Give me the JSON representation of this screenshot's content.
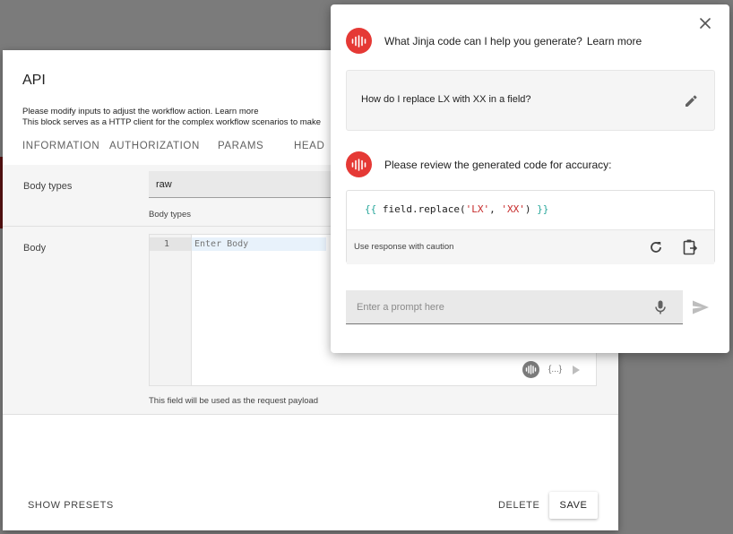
{
  "api_dialog": {
    "title": "API",
    "description_line1": "Please modify inputs to adjust the workflow action.",
    "learn_more": "Learn more",
    "description_line2": "This block serves as a HTTP client for the complex workflow scenarios to make",
    "tabs": [
      "INFORMATION",
      "AUTHORIZATION",
      "PARAMS",
      "HEAD"
    ],
    "body_types_label": "Body types",
    "body_types_value": "raw",
    "body_types_helper": "Body types",
    "body_label": "Body",
    "editor_line_number": "1",
    "editor_placeholder": "Enter Body",
    "editor_braces": "{...}",
    "body_helper": "This field will be used as the request payload",
    "footer": {
      "show_presets": "SHOW PRESETS",
      "delete": "DELETE",
      "save": "SAVE"
    }
  },
  "ai_panel": {
    "question_title": "What Jinja code can I help you generate?",
    "learn_more": "Learn more",
    "user_prompt": "How do I replace LX with XX in a field?",
    "review_title": "Please review the generated code for accuracy:",
    "code": {
      "open": "{{ ",
      "func": "field.replace(",
      "arg1": "'LX'",
      "sep": ", ",
      "arg2": "'XX'",
      "close_paren": ") ",
      "close": "}}"
    },
    "caution": "Use response with caution",
    "input_placeholder": "Enter a prompt here",
    "icons": [
      "waveform-icon",
      "close-icon",
      "pencil-icon",
      "refresh-icon",
      "clipboard-icon",
      "microphone-icon",
      "send-icon"
    ],
    "colors": {
      "brand": "#e53935",
      "code_braces": "#26a69a",
      "code_string": "#c62828"
    }
  }
}
